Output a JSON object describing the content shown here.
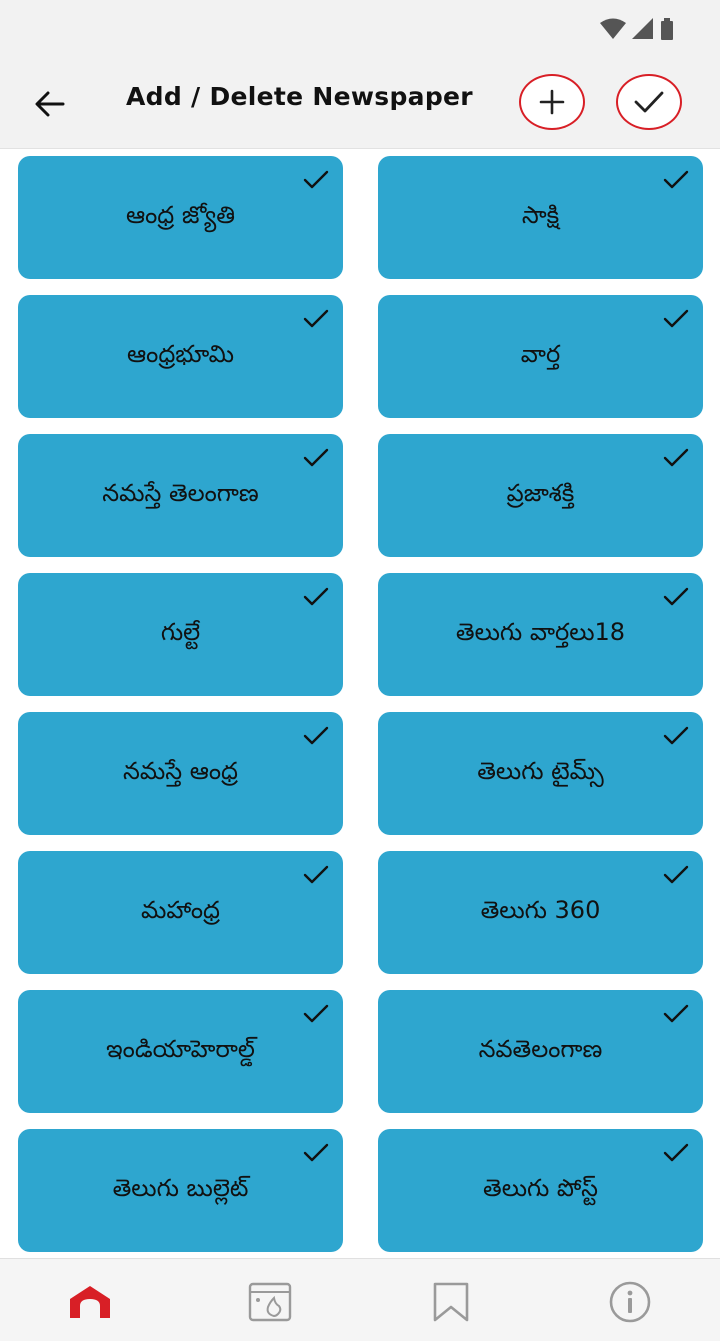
{
  "status_bar": {
    "icons": [
      "wifi-icon",
      "signal-icon",
      "battery-icon"
    ]
  },
  "header": {
    "title": "Add / Delete Newspaper",
    "back_icon": "arrow-left-icon",
    "add_icon": "plus-icon",
    "done_icon": "check-icon"
  },
  "newspapers": [
    {
      "name": "ఆంధ్ర జ్యోతి",
      "selected": true
    },
    {
      "name": "సాక్షి",
      "selected": true
    },
    {
      "name": "ఆంధ్రభూమి",
      "selected": true
    },
    {
      "name": "వార్త",
      "selected": true
    },
    {
      "name": "నమస్తే తెలంగాణ",
      "selected": true
    },
    {
      "name": "ప్రజాశక్తి",
      "selected": true
    },
    {
      "name": "గుల్టే",
      "selected": true
    },
    {
      "name": "తెలుగు వార్తలు18",
      "selected": true
    },
    {
      "name": "నమస్తే ఆంధ్ర",
      "selected": true
    },
    {
      "name": "తెలుగు టైమ్స్",
      "selected": true
    },
    {
      "name": "మహాంధ్ర",
      "selected": true
    },
    {
      "name": "తెలుగు 360",
      "selected": true
    },
    {
      "name": "ఇండియాహెరాల్డ్",
      "selected": true
    },
    {
      "name": "నవతెలంగాణ",
      "selected": true
    },
    {
      "name": "తెలుగు బుల్లెట్",
      "selected": true
    },
    {
      "name": "తెలుగు పోస్ట్",
      "selected": true
    }
  ],
  "bottom_nav": {
    "items": [
      "home-icon",
      "gallery-icon",
      "bookmark-icon",
      "info-icon"
    ],
    "active_index": 0
  },
  "colors": {
    "accent": "#d81f26",
    "tile": "#2ea6cf",
    "icon_inactive": "#9a9a9a"
  }
}
